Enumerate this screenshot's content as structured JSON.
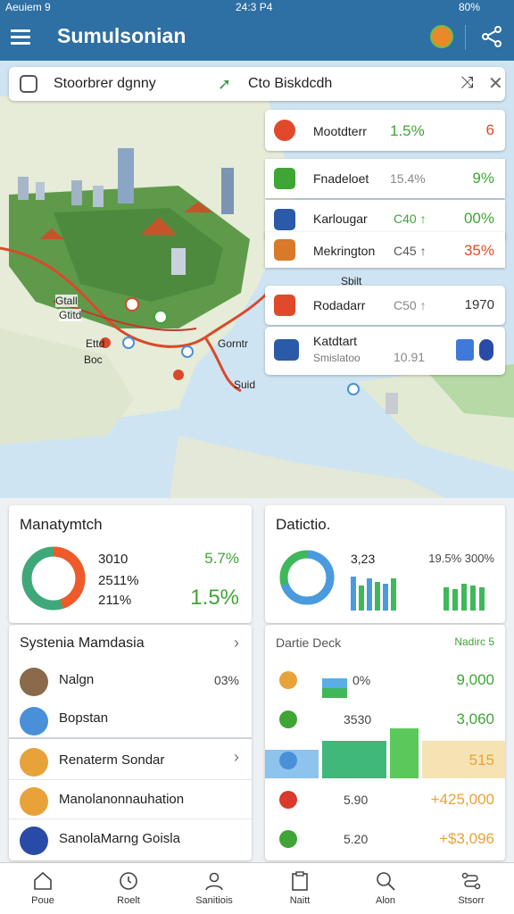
{
  "status": {
    "left": "Aeuiem 9",
    "time": "24:3 P4",
    "battery": "80%"
  },
  "appbar": {
    "title": "Sumulsonian"
  },
  "search": {
    "origin": "Stoorbrer dgnny",
    "destination": "Cto Biskdcdh"
  },
  "map_labels": {
    "l1": "Gtall",
    "l2": "Gtitd",
    "l3": "Ettd",
    "l4": "Boc",
    "l5": "Gorntr",
    "l6": "Suid",
    "l7": "Sbilt"
  },
  "routes": [
    {
      "name": "Mootdterr",
      "v1": "1.5%",
      "v2": "6",
      "v1_color": "#3fa535",
      "v2_color": "#e24a2a",
      "icon": "transit-icon",
      "icon_color": "#e04a2a"
    },
    {
      "name": "Fnadeloet",
      "v1": "15.4%",
      "v2": "9%",
      "v1_color": "#888888",
      "v2_color": "#3fa535",
      "icon": "route-icon",
      "icon_color": "#3fa535"
    },
    {
      "name": "Karlougar",
      "v1": "C40 ↑",
      "v2": "00%",
      "v1_color": "#3fa535",
      "v2_color": "#3fa535",
      "icon": "flag-icon",
      "icon_color": "#2a5aa8"
    },
    {
      "name": "Mekrington",
      "v1": "C45 ↑",
      "v2": "35%",
      "v1_color": "#555555",
      "v2_color": "#e24a2a",
      "icon": "building-icon",
      "icon_color": "#d87a2a"
    },
    {
      "name": "Rodadarr",
      "v1": "C50 ↑",
      "v2": "1970",
      "v1_color": "#888888",
      "v2_color": "#333333",
      "icon": "car-icon",
      "icon_color": "#e04a2a"
    },
    {
      "name": "Katdtart",
      "sub": "Smislatoo",
      "v1": "10.91",
      "v1_color": "#888888",
      "icon": "image-icon",
      "icon_color": "#2a5aa8"
    }
  ],
  "manage": {
    "title": "Manatymtch",
    "values": [
      "3010",
      "2511%",
      "211%"
    ],
    "pct_top": "5.7%",
    "pct_big": "1.5%",
    "donut_share": 0.45,
    "colors": [
      "#ef5a2a",
      "#3fa87a"
    ]
  },
  "stats": {
    "title": "Datictio.",
    "value": "3,23",
    "pct": "19.5% 300%",
    "donut_share": 0.7,
    "bars_blue": [
      38,
      28,
      36,
      32,
      30,
      36
    ],
    "bars_green": [
      26,
      24,
      30,
      28,
      26
    ]
  },
  "systems": {
    "title": "Systenia Mamdasia",
    "items": [
      {
        "label": "Nalgn",
        "value": "03%",
        "icon": "avatar-icon",
        "color": "#8a6a4a"
      },
      {
        "label": "Bopstan",
        "value": "",
        "icon": "plane-icon",
        "color": "#4a90d9"
      },
      {
        "label": "Renaterm Sondar",
        "value": "",
        "icon": "folder-icon",
        "color": "#e8a23a"
      },
      {
        "label": "Manolanonnauhation",
        "value": "",
        "icon": "calendar-icon",
        "color": "#e8a23a"
      },
      {
        "label": "SanolaMarng Goisla",
        "value": "",
        "icon": "chart-icon",
        "color": "#2a4aa8"
      }
    ]
  },
  "detail": {
    "title": "Dartie Deck",
    "right": "Nadirc 5",
    "rows": [
      {
        "mid": "0%",
        "value": "9,000",
        "dot": "#e8a23a",
        "value_color": "#3fa535"
      },
      {
        "mid": "3530",
        "value": "3,060",
        "dot": "#3fa535",
        "value_color": "#3fa535"
      },
      {
        "mid": "",
        "value": "515",
        "dot": "#4a90d9",
        "value_color": "#e8a23a"
      },
      {
        "mid": "5.90",
        "value": "+425,000",
        "dot": "#d93a2a",
        "value_color": "#e8a23a"
      },
      {
        "mid": "5.20",
        "value": "+$3,096",
        "dot": "#3fa535",
        "value_color": "#e8a23a"
      }
    ]
  },
  "nav": [
    {
      "label": "Poue",
      "icon": "home-icon"
    },
    {
      "label": "Roelt",
      "icon": "clock-icon"
    },
    {
      "label": "Sanitiois",
      "icon": "person-icon"
    },
    {
      "label": "Naitt",
      "icon": "clipboard-icon"
    },
    {
      "label": "Alon",
      "icon": "search-icon"
    },
    {
      "label": "Stsorr",
      "icon": "route-icon"
    }
  ]
}
